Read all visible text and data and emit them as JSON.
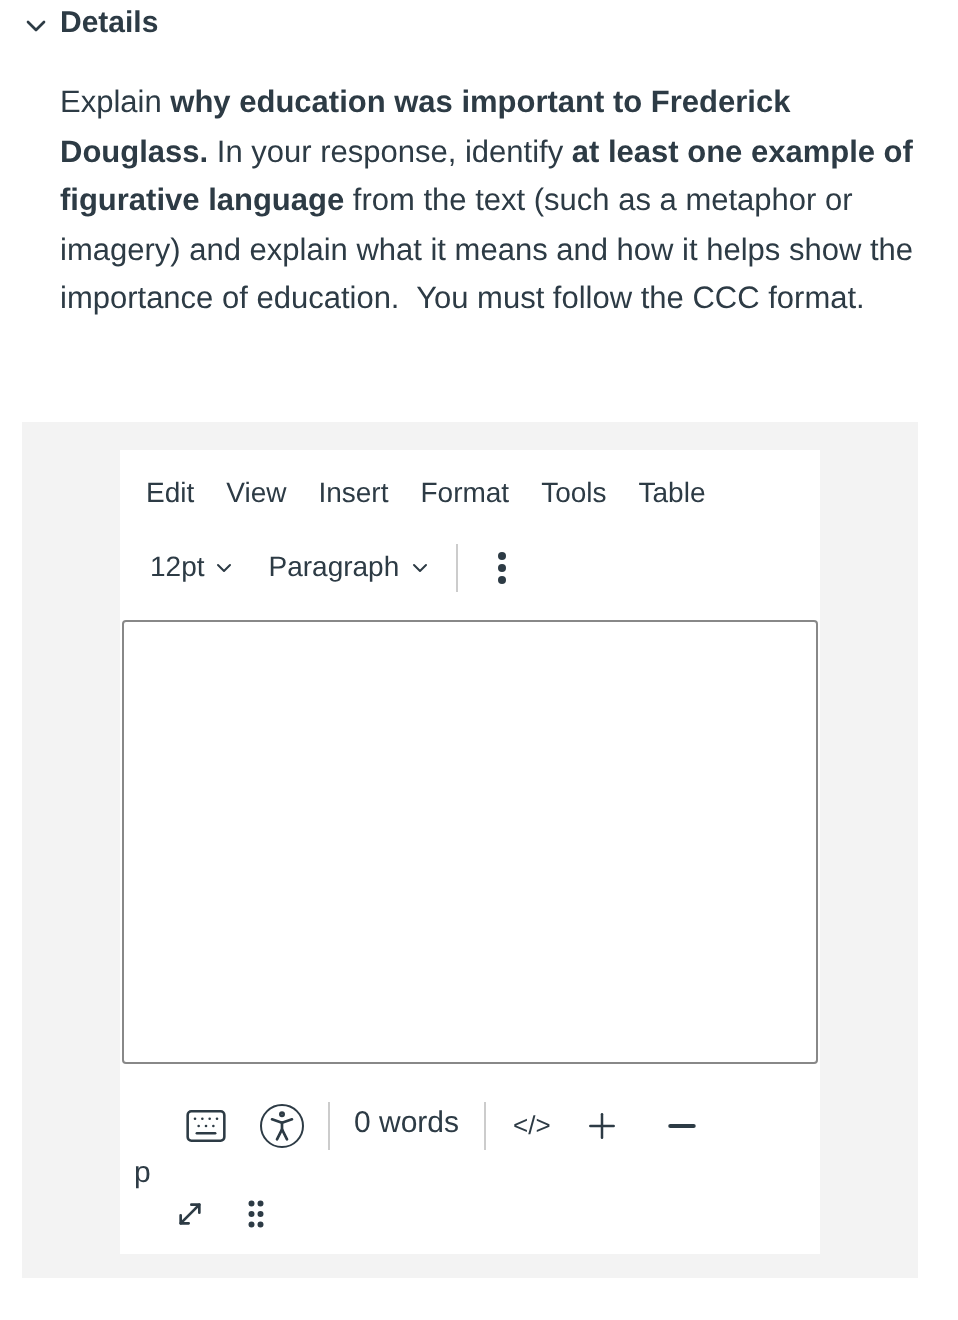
{
  "section": {
    "title": "Details",
    "expanded": true
  },
  "prompt": "Explain **why education was important to Frederick Douglass.** In your response, identify **at least one example of figurative language** from the text (such as a metaphor or imagery) and explain what it means and how it helps show the importance of education.  You must follow the CCC format.",
  "editor": {
    "menu": [
      "Edit",
      "View",
      "Insert",
      "Format",
      "Tools",
      "Table"
    ],
    "font_size": "12pt",
    "block_format": "Paragraph",
    "word_count": "0 words",
    "html_toggle": "</>",
    "element_path": "p"
  }
}
